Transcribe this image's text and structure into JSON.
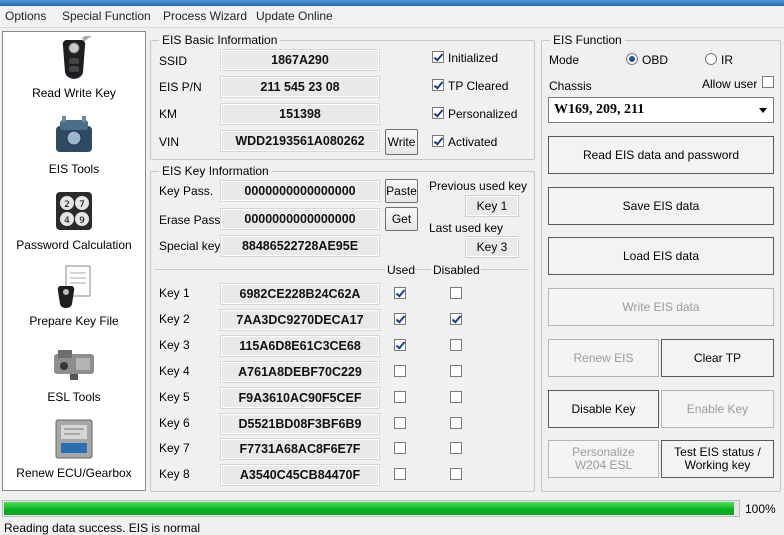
{
  "menu": [
    "Options",
    "Special Function",
    "Process Wizard",
    "Update Online"
  ],
  "sidebar": [
    {
      "label": "Read Write Key",
      "icon": "car-key-icon"
    },
    {
      "label": "EIS Tools",
      "icon": "eis-module-icon"
    },
    {
      "label": "Password Calculation",
      "icon": "password-dial-icon"
    },
    {
      "label": "Prepare Key File",
      "icon": "key-file-icon"
    },
    {
      "label": "ESL Tools",
      "icon": "esl-lock-icon"
    },
    {
      "label": "Renew ECU/Gearbox",
      "icon": "ecu-module-icon"
    }
  ],
  "basic": {
    "title": "EIS Basic Information",
    "ssid_label": "SSID",
    "ssid": "1867A290",
    "pn_label": "EIS P/N",
    "pn": "211 545 23 08",
    "km_label": "KM",
    "km": "151398",
    "vin_label": "VIN",
    "vin": "WDD2193561A080262",
    "write_label": "Write",
    "checks": [
      {
        "label": "Initialized",
        "checked": true
      },
      {
        "label": "TP Cleared",
        "checked": true
      },
      {
        "label": "Personalized",
        "checked": true
      },
      {
        "label": "Activated",
        "checked": true
      }
    ]
  },
  "keyinfo": {
    "title": "EIS Key Information",
    "keypass_label": "Key Pass.",
    "keypass": "0000000000000000",
    "erase_label": "Erase Pass.",
    "erase": "0000000000000000",
    "special_label": "Special key",
    "special": "88486522728AE95E",
    "paste_label": "Paste",
    "get_label": "Get",
    "prev_label": "Previous used key",
    "prev_value": "Key 1",
    "last_label": "Last used key",
    "last_value": "Key 3",
    "used_header": "Used",
    "disabled_header": "Disabled",
    "keys": [
      {
        "label": "Key 1",
        "value": "6982CE228B24C62A",
        "used": true,
        "disabled": false
      },
      {
        "label": "Key 2",
        "value": "7AA3DC9270DECA17",
        "used": true,
        "disabled": true
      },
      {
        "label": "Key 3",
        "value": "115A6D8E61C3CE68",
        "used": true,
        "disabled": false
      },
      {
        "label": "Key 4",
        "value": "A761A8DEBF70C229",
        "used": false,
        "disabled": false
      },
      {
        "label": "Key 5",
        "value": "F9A3610AC90F5CEF",
        "used": false,
        "disabled": false
      },
      {
        "label": "Key 6",
        "value": "D5521BD08F3BF6B9",
        "used": false,
        "disabled": false
      },
      {
        "label": "Key 7",
        "value": "F7731A68AC8F6E7F",
        "used": false,
        "disabled": false
      },
      {
        "label": "Key 8",
        "value": "A3540C45CB84470F",
        "used": false,
        "disabled": false
      }
    ]
  },
  "func": {
    "title": "EIS Function",
    "mode_label": "Mode",
    "mode_obd": "OBD",
    "mode_ir": "IR",
    "mode_selected": "OBD",
    "chassis_label": "Chassis",
    "allow_user_label": "Allow user",
    "allow_user": false,
    "chassis_value": "W169, 209, 211",
    "read_label": "Read EIS data and password",
    "save_label": "Save EIS data",
    "load_label": "Load EIS data",
    "write_label": "Write EIS data",
    "renew_label": "Renew EIS",
    "clear_tp_label": "Clear TP",
    "disable_key_label": "Disable Key",
    "enable_key_label": "Enable Key",
    "personalize_label": "Personalize W204 ESL",
    "test_label": "Test EIS status / Working key"
  },
  "progress": {
    "value": 100,
    "label": "100%"
  },
  "status": "Reading data success.  EIS is normal",
  "colors": {
    "progress": "#07b021",
    "titlebar": "#3a80c8"
  }
}
